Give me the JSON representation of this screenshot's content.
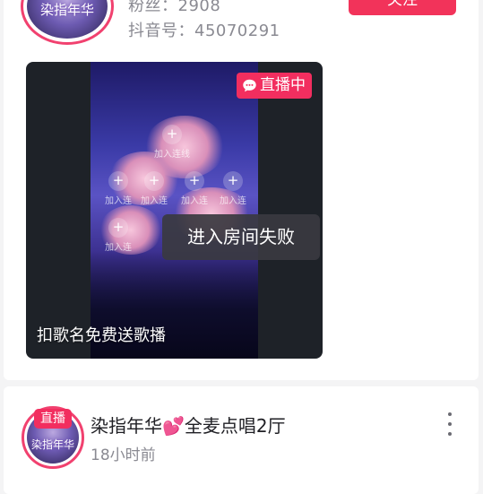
{
  "profile": {
    "avatar_text": "染指年华",
    "fans": "粉丝：2908",
    "douyin_id": "抖音号：45070291",
    "follow_label": "关注"
  },
  "live_video": {
    "badge": "直播中",
    "title": "扣歌名免费送歌播",
    "seats": [
      "加入连线",
      "加入连",
      "加入连",
      "加入连",
      "加入连",
      "加入连"
    ]
  },
  "toast": {
    "message": "进入房间失败"
  },
  "post": {
    "live_tag": "直播",
    "avatar_text": "染指年华",
    "title": "染指年华💕全麦点唱2厅",
    "time": "18小时前"
  },
  "colors": {
    "accent": "#f2335a",
    "muted": "#8a8a92"
  }
}
